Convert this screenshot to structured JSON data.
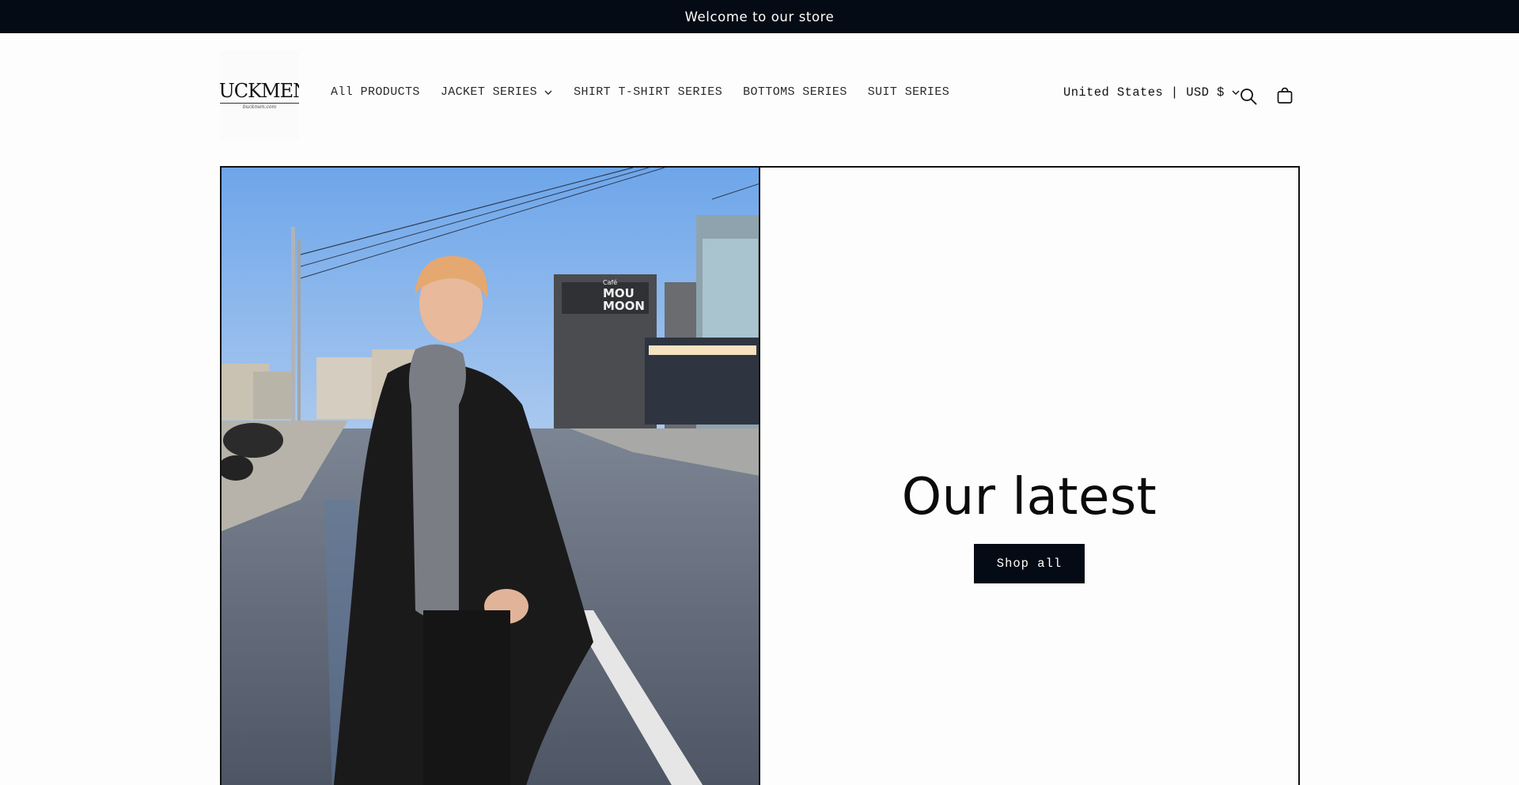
{
  "announcement": {
    "text": "Welcome to our store"
  },
  "header": {
    "logo": {
      "wordmark": "BUCKMEN",
      "subtext": "buckmen.com"
    },
    "nav": [
      {
        "label": "All PRODUCTS",
        "has_dropdown": false
      },
      {
        "label": "JACKET SERIES",
        "has_dropdown": true
      },
      {
        "label": "SHIRT T-SHIRT SERIES",
        "has_dropdown": false
      },
      {
        "label": "BOTTOMS SERIES",
        "has_dropdown": false
      },
      {
        "label": "SUIT SERIES",
        "has_dropdown": false
      }
    ],
    "locale": {
      "label": "United States | USD $"
    },
    "icons": {
      "search": "search-icon",
      "cart": "cart-icon"
    }
  },
  "hero": {
    "title": "Our latest",
    "button_label": "Shop all",
    "image": {
      "sign_line1": "Café",
      "sign_line2": "MOU",
      "sign_line3": "MOON"
    }
  },
  "colors": {
    "announcement_bg": "#050b14",
    "button_bg": "#050b14",
    "page_bg": "#fdfdfd",
    "sky": "#7fb1ea",
    "text": "#111111"
  }
}
